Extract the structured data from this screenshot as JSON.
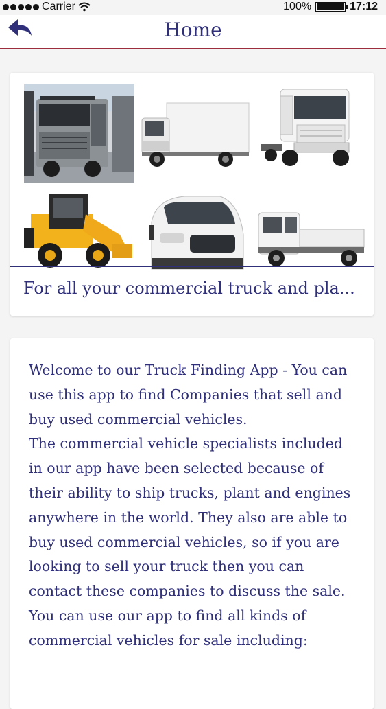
{
  "status_bar": {
    "carrier": "Carrier",
    "battery_text": "100%",
    "battery_level": 1.0,
    "time": "17:12"
  },
  "nav": {
    "title": "Home",
    "back_icon": "back-arrow-icon",
    "accent_color": "#9c2d3c",
    "title_color": "#2f2f7a"
  },
  "banner": {
    "images": [
      "grey-tipper-truck-image",
      "white-box-truck-image",
      "white-tractor-unit-image",
      "yellow-telehandler-image",
      "white-van-image",
      "white-flatbed-truck-image"
    ],
    "caption": "For all your commercial truck and pla..."
  },
  "welcome": {
    "paragraphs": [
      "Welcome to our Truck Finding App - You can use this app to find Companies that sell and buy used commercial vehicles.",
      "The commercial vehicle specialists included in our app have been selected because of their ability to ship trucks, plant and engines anywhere in the world. They also are able to buy used commercial vehicles, so if you are looking to sell your truck then you can contact these companies to discuss the sale.",
      "You can use our app to find all kinds of commercial vehicles for sale including:"
    ]
  }
}
